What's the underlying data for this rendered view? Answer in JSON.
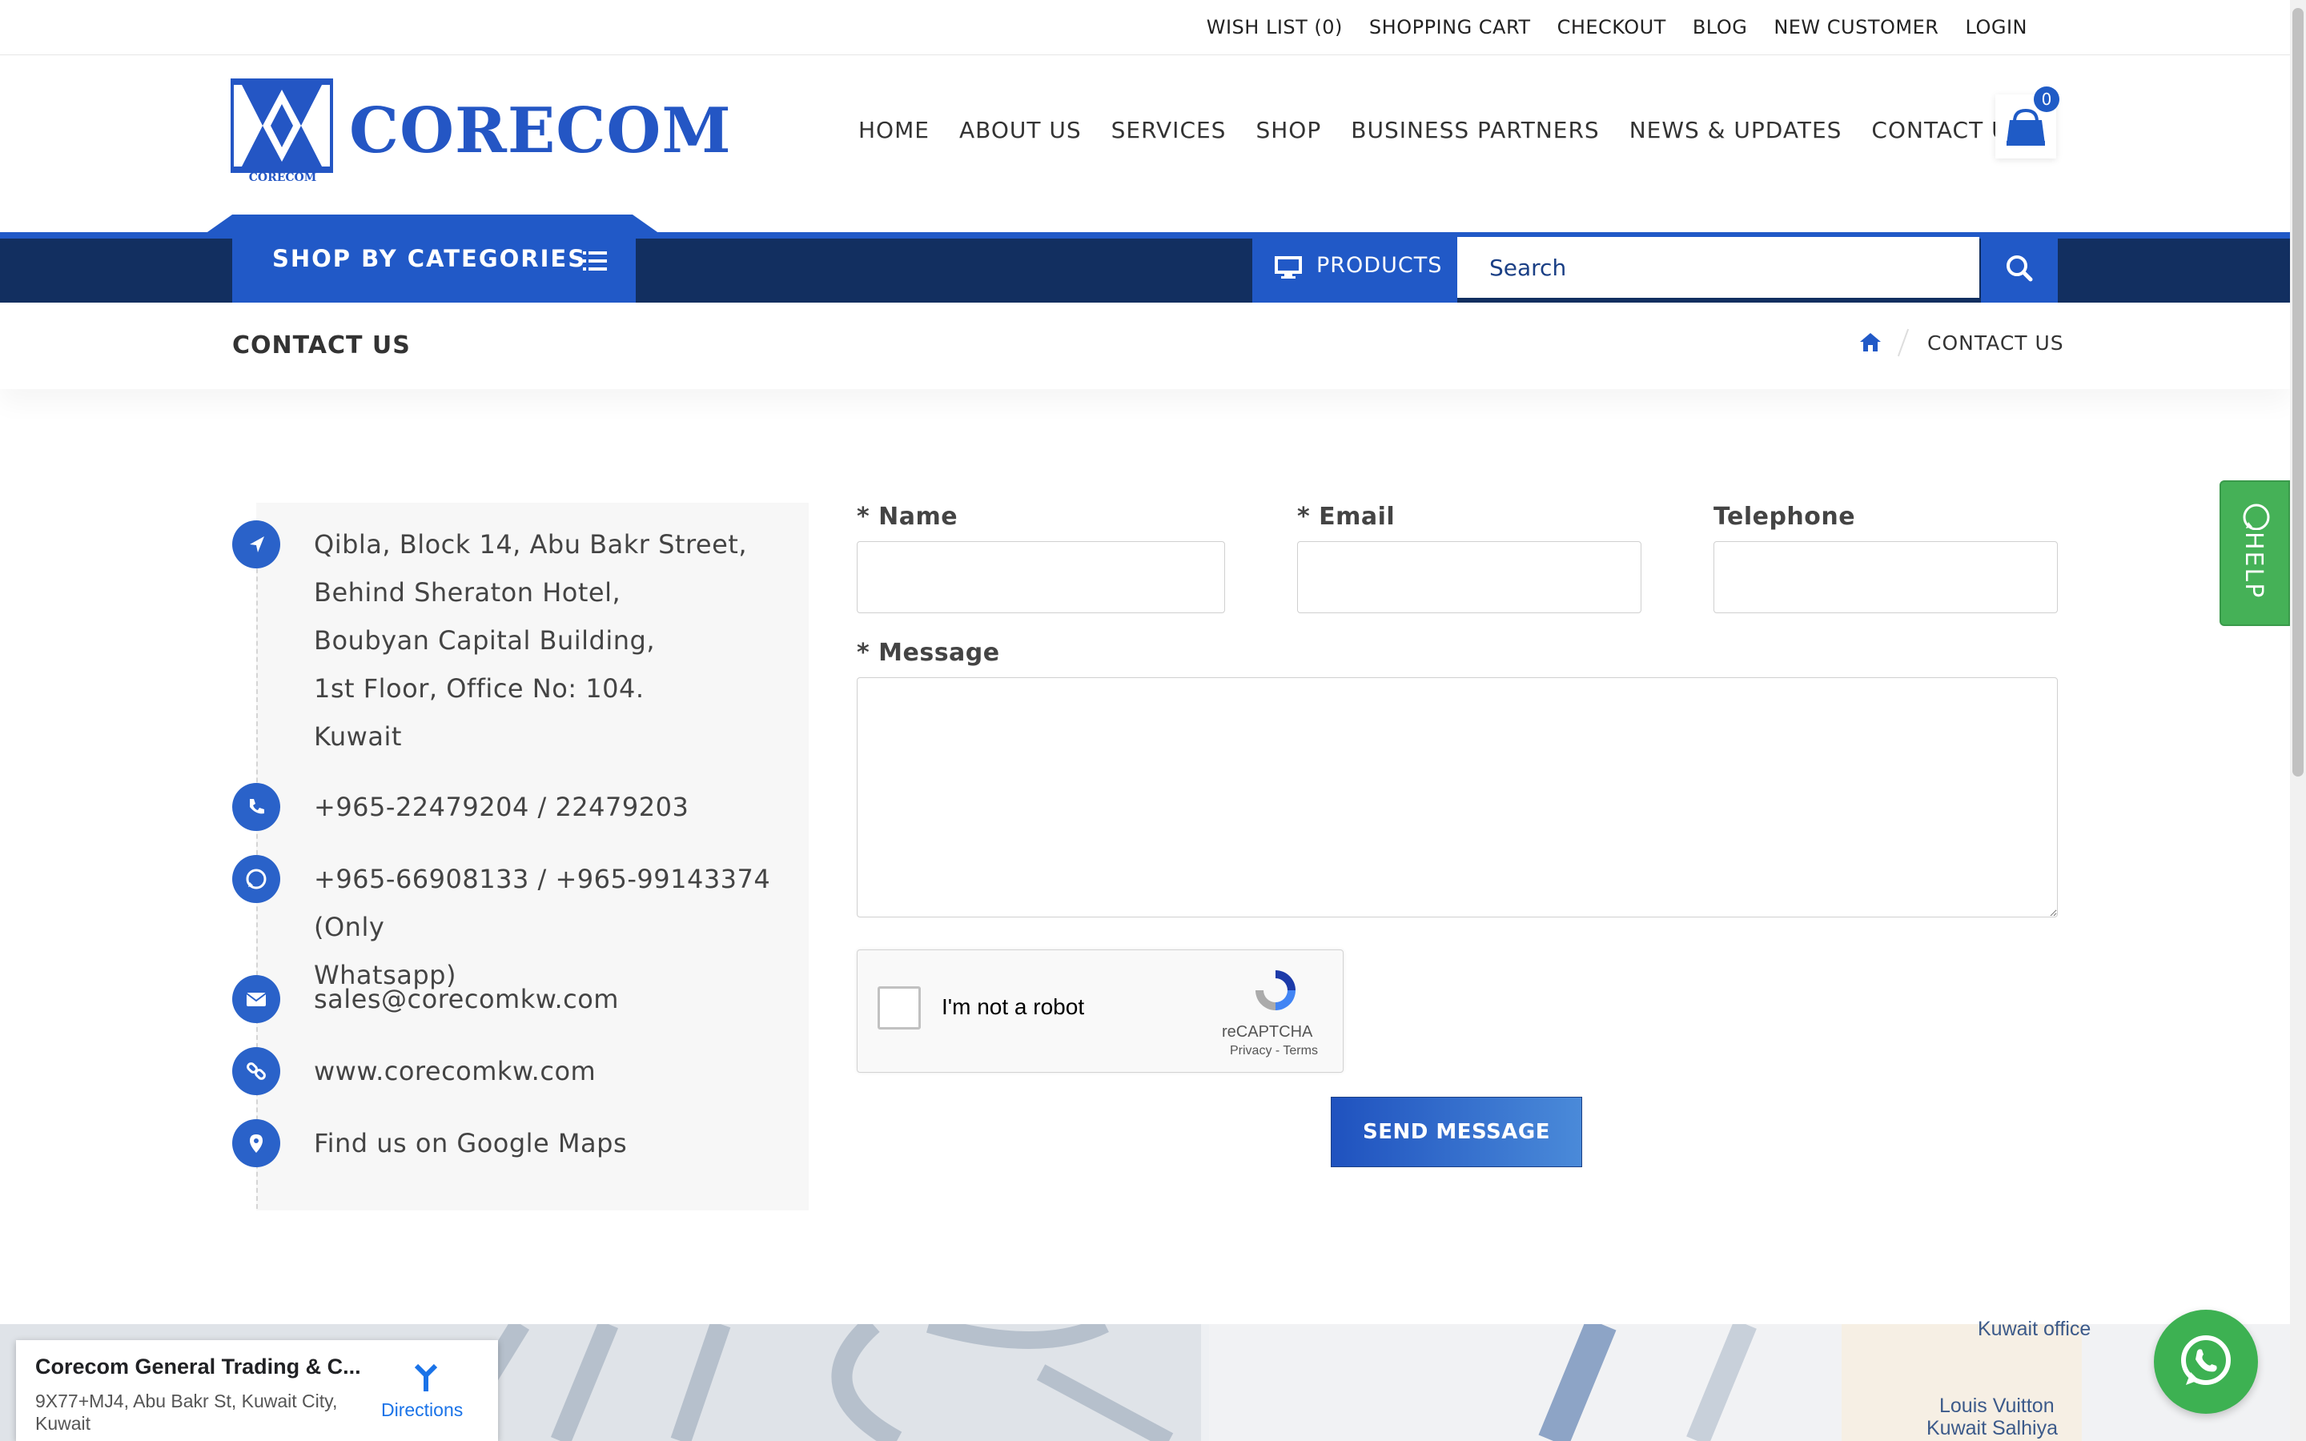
{
  "topbar": {
    "links": [
      "WISH LIST (0)",
      "SHOPPING CART",
      "CHECKOUT",
      "BLOG",
      "NEW CUSTOMER",
      "LOGIN"
    ]
  },
  "brand": {
    "name": "CORECOM",
    "sub": "CORECOM",
    "color": "#2456c4"
  },
  "nav": [
    "HOME",
    "ABOUT US",
    "SERVICES",
    "SHOP",
    "BUSINESS PARTNERS",
    "NEWS & UPDATES",
    "CONTACT US"
  ],
  "cart": {
    "count": "0",
    "icon": "shopping-bag-icon"
  },
  "category_bar": {
    "shop_by_categories": "SHOP BY CATEGORIES",
    "products": "PRODUCTS",
    "search_placeholder": "Search",
    "accent": "#2159c7",
    "dark": "#122f60"
  },
  "page": {
    "title": "CONTACT US",
    "breadcrumb_current": "CONTACT US"
  },
  "contact": {
    "address_lines": [
      "Qibla, Block 14, Abu Bakr Street,",
      "Behind Sheraton Hotel,",
      "Boubyan Capital Building,",
      "1st Floor, Office No: 104.",
      "Kuwait"
    ],
    "phone": "+965-22479204 / 22479203",
    "whatsapp_line1": "+965-66908133 / +965-99143374 (Only",
    "whatsapp_line2": "Whatsapp)",
    "email": "sales@corecomkw.com",
    "website": "www.corecomkw.com",
    "maps": "Find us on Google Maps"
  },
  "form": {
    "name_label": "* Name",
    "email_label": "* Email",
    "telephone_label": "Telephone",
    "message_label": "* Message",
    "name_value": "",
    "email_value": "",
    "telephone_value": "",
    "message_value": "",
    "recaptcha_label": "I'm not a robot",
    "recaptcha_brand": "reCAPTCHA",
    "recaptcha_terms": "Privacy - Terms",
    "submit": "SEND MESSAGE"
  },
  "map": {
    "place_title": "Corecom General Trading & C...",
    "place_address": "9X77+MJ4, Abu Bakr St, Kuwait City, Kuwait",
    "directions": "Directions",
    "labels": [
      "Kuwait office",
      "Louis Vuitton",
      "Kuwait Salhiya"
    ]
  },
  "floating": {
    "help": "HELP"
  }
}
